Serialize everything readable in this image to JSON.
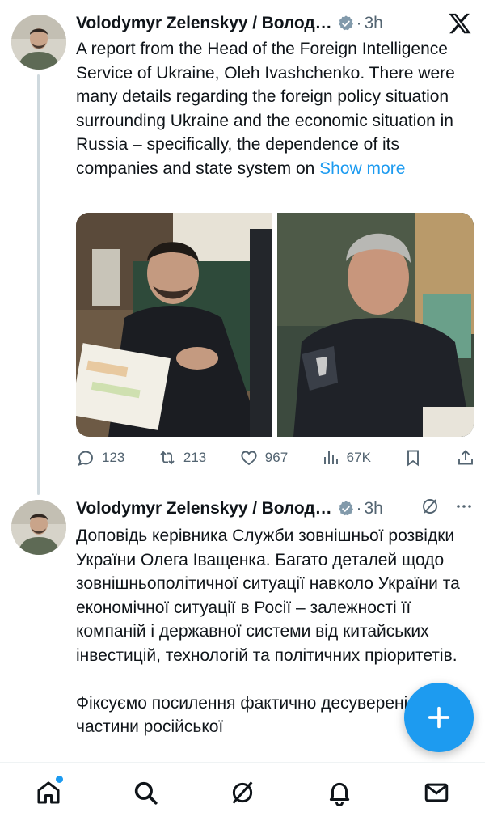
{
  "tweets": [
    {
      "author": "Volodymyr Zelenskyy / Волод…",
      "time": "3h",
      "text": "A report from the Head of the Foreign Intelligence Service of Ukraine, Oleh Ivashchenko. There were many details regarding the foreign policy situation surrounding Ukraine and the economic situation in Russia – specifically, the dependence of its companies and state system on",
      "show_more": "Show more",
      "stats": {
        "replies": "123",
        "reposts": "213",
        "likes": "967",
        "views": "67K"
      }
    },
    {
      "author": "Volodymyr Zelenskyy / Волод…",
      "time": "3h",
      "text": "Доповідь керівника Служби зовнішньої розвідки України Олега Іващенка. Багато деталей щодо зовнішньополітичної ситуації навколо України та економічної ситуації в Росії – залежності її компаній і державної системи від китайських інвестицій, технологій та політичних пріоритетів.",
      "text2": "Фіксуємо посилення фактично десуверенізації частини російської"
    }
  ],
  "separator": "·",
  "icons": {
    "top": "x-logo-icon",
    "reply": "reply-icon",
    "repost": "repost-icon",
    "like": "heart-icon",
    "views": "views-icon",
    "bookmark": "bookmark-icon",
    "share": "share-icon",
    "grok": "grok-icon",
    "more": "more-icon",
    "compose": "plus-icon"
  },
  "nav": [
    "home-icon",
    "search-icon",
    "grok-icon",
    "notifications-icon",
    "messages-icon"
  ],
  "colors": {
    "accent": "#1d9bf0",
    "text": "#0f1419",
    "muted": "#536471"
  }
}
